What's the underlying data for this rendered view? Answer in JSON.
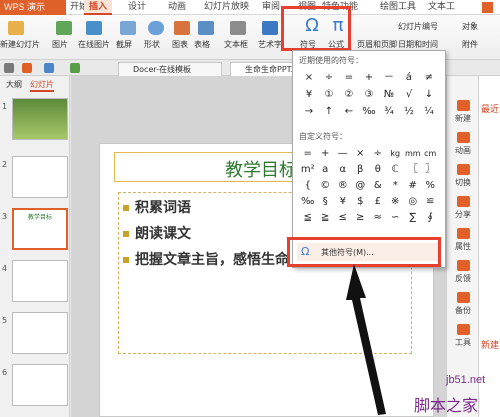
{
  "app": {
    "name": "WPS 演示"
  },
  "menu": {
    "items": [
      "开始",
      "插入",
      "设计",
      "动画",
      "幻灯片放映",
      "审阅",
      "视图",
      "特色功能",
      "绘图工具",
      "文本工"
    ],
    "active": "插入"
  },
  "ribbon": {
    "buttons": [
      "新建幻灯片",
      "图片",
      "在线图片",
      "截屏",
      "形状",
      "图表",
      "表格",
      "文本框",
      "艺术字",
      "符号",
      "公式",
      "页眉和页脚",
      "幻灯片编号",
      "日期和时间",
      "对象",
      "附件"
    ],
    "symbol_glyph": "Ω",
    "formula_glyph": "π"
  },
  "tabs": [
    "Docer-在线模板",
    "生命生命PPT..."
  ],
  "left_panel": {
    "tabs": [
      "大纲",
      "幻灯片"
    ],
    "slide_numbers": [
      "1",
      "2",
      "3",
      "4",
      "5",
      "6"
    ],
    "thumb_title": "教学目标"
  },
  "slide": {
    "title": "教学目标",
    "bullets": [
      "积累词语",
      "朗读课文",
      "把握文章主旨，感悟生命"
    ]
  },
  "right_panel": {
    "items": [
      "新建",
      "动画",
      "切换",
      "分享",
      "属性",
      "反馈",
      "备份",
      "工具"
    ],
    "edge_items": [
      "最近",
      "新建"
    ]
  },
  "symbol_dropdown": {
    "recent_title": "近期使用的符号：",
    "recent": [
      "×",
      "÷",
      "=",
      "+",
      "－",
      "á",
      "≠",
      "¥",
      "①",
      "②",
      "③",
      "№",
      "√",
      "↓",
      "→",
      "↑",
      "←",
      "‰",
      "¾",
      "½",
      "¼"
    ],
    "custom_title": "自定义符号：",
    "custom": [
      "=",
      "+",
      "—",
      "×",
      "÷",
      "kg",
      "mm",
      "cm",
      "m²",
      "a",
      "α",
      "β",
      "θ",
      "ℂ",
      "〖",
      "〗",
      "{",
      "©",
      "®",
      "@",
      "&",
      "*",
      "#",
      "%",
      "‰",
      "§",
      "¥",
      "$",
      "£",
      "※",
      "◎",
      "≌",
      "≦",
      "≧",
      "≤",
      "≥",
      "≈",
      "∽",
      "∑",
      "∮"
    ],
    "more_label": "其他符号(M)..."
  },
  "watermark": {
    "site": "jb51.net",
    "name": "脚本之家"
  },
  "colors": {
    "accent": "#d24726",
    "highlight": "#e8402f",
    "title_green": "#2d7a2f",
    "bullet": "#c9a227"
  }
}
